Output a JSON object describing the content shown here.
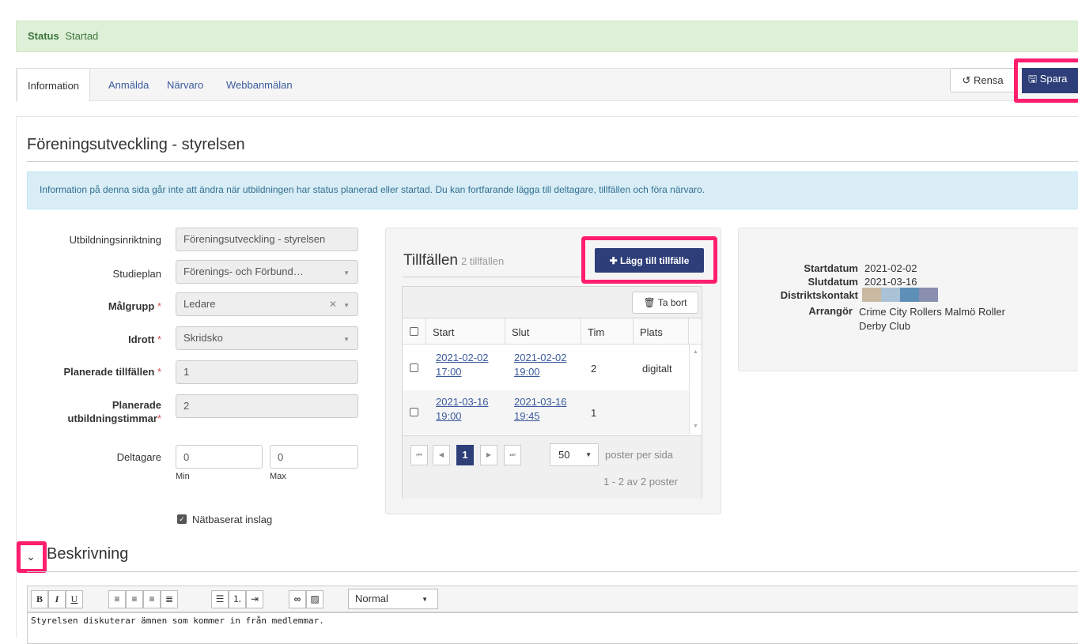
{
  "status": {
    "label": "Status",
    "value": "Startad"
  },
  "tabs": [
    "Information",
    "Anmälda",
    "Närvaro",
    "Webbanmälan"
  ],
  "actions": {
    "rensa": "Rensa",
    "spara": "Spara"
  },
  "page_title": "Föreningsutveckling - styrelsen",
  "info_message": "Information på denna sida går inte att ändra när utbildningen har status planerad eller startad. Du kan fortfarande lägga till deltagare, tillfällen och föra närvaro.",
  "form": {
    "utbildningsinriktning": {
      "label": "Utbildningsinriktning",
      "value": "Föreningsutveckling - styrelsen"
    },
    "studieplan": {
      "label": "Studieplan",
      "value": "Förenings- och Förbund…"
    },
    "malgrupp": {
      "label": "Målgrupp",
      "value": "Ledare"
    },
    "idrott": {
      "label": "Idrott",
      "value": "Skridsko"
    },
    "planerade_tillfallen": {
      "label": "Planerade tillfällen",
      "value": "1"
    },
    "planerade_timmar": {
      "label_line1": "Planerade",
      "label_line2": "utbildningstimmar",
      "value": "2"
    },
    "deltagare": {
      "label": "Deltagare",
      "min": "0",
      "max": "0",
      "min_label": "Min",
      "max_label": "Max"
    },
    "natbaserat": {
      "label": "Nätbaserat inslag",
      "checked": true
    },
    "required_mark": "*"
  },
  "tillfallen": {
    "title": "Tillfällen",
    "subtitle": "2 tillfällen",
    "add_button": "Lägg till tillfälle",
    "delete_button": "Ta bort",
    "columns": [
      "Start",
      "Slut",
      "Tim",
      "Plats"
    ],
    "rows": [
      {
        "start_date": "2021-02-02",
        "start_time": "17:00",
        "end_date": "2021-02-02",
        "end_time": "19:00",
        "tim": "2",
        "plats": "digitalt"
      },
      {
        "start_date": "2021-03-16",
        "start_time": "19:00",
        "end_date": "2021-03-16",
        "end_time": "19:45",
        "tim": "1",
        "plats": ""
      }
    ],
    "pager": {
      "current_page": "1",
      "page_size": "50",
      "per_page_label": "poster per sida",
      "summary": "1 - 2 av 2 poster"
    }
  },
  "details": {
    "startdatum": {
      "label": "Startdatum",
      "value": "2021-02-02"
    },
    "slutdatum": {
      "label": "Slutdatum",
      "value": "2021-03-16"
    },
    "distriktskontakt": {
      "label": "Distriktskontakt",
      "swatch_colors": [
        "#c9b9a0",
        "#a9c2d6",
        "#5e8fb8",
        "#8a8fb0"
      ]
    },
    "arrangor": {
      "label": "Arrangör",
      "value_line1": "Crime City Rollers Malmö Roller",
      "value_line2": "Derby Club"
    }
  },
  "beskrivning": {
    "title": "Beskrivning",
    "format_select": "Normal",
    "text": "Styrelsen diskuterar ämnen som kommer in från medlemmar."
  },
  "colors": {
    "primary": "#2d3e79",
    "highlight": "#ff1e6e",
    "success_bg": "#dff0d8",
    "info_bg": "#d9edf7"
  }
}
